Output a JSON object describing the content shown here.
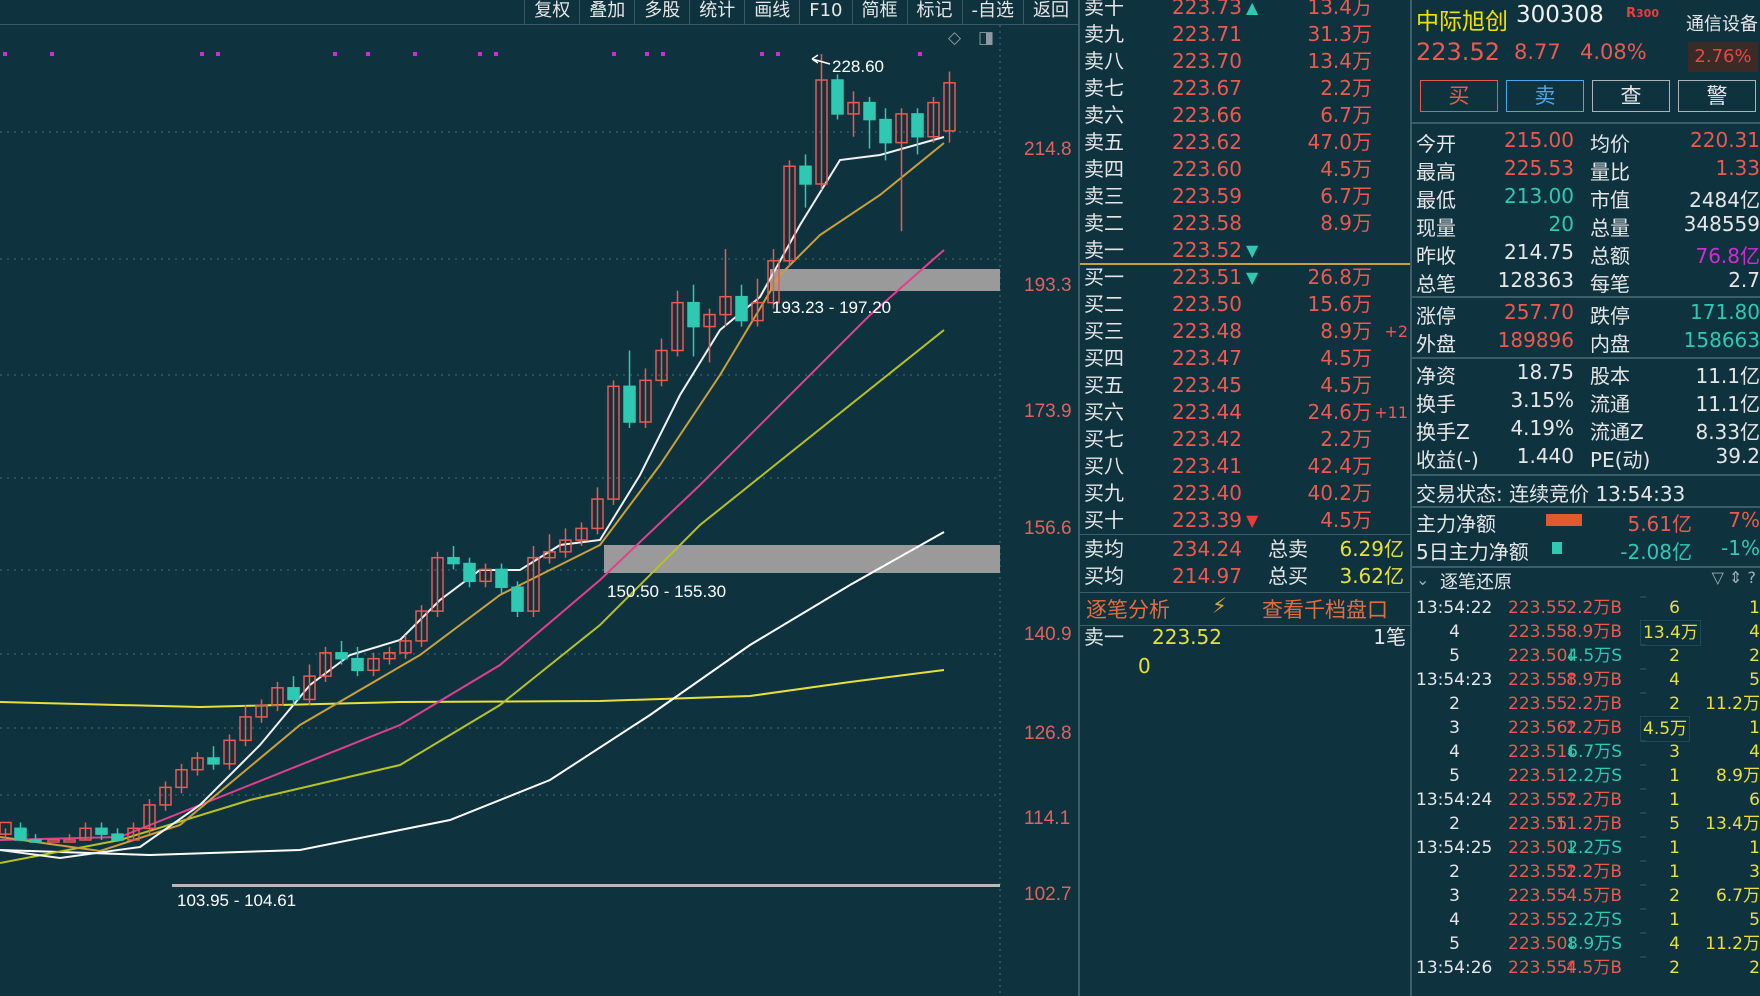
{
  "toolbar": {
    "buttons": [
      "复权",
      "叠加",
      "多股",
      "统计",
      "画线",
      "F10",
      "简框",
      "标记",
      "-自选",
      "返回"
    ]
  },
  "chart": {
    "price_axis": [
      "214.8",
      "193.3",
      "173.9",
      "156.6",
      "140.9",
      "126.8",
      "114.1",
      "102.7"
    ],
    "peak_label": "228.60",
    "zones": [
      "193.23 - 197.20",
      "150.50 - 155.30",
      "103.95 - 104.61"
    ]
  },
  "orderbook": {
    "asks": [
      {
        "label": "卖十",
        "price": "223.73",
        "vol": "13.4万"
      },
      {
        "label": "卖九",
        "price": "223.71",
        "vol": "31.3万"
      },
      {
        "label": "卖八",
        "price": "223.70",
        "vol": "13.4万"
      },
      {
        "label": "卖七",
        "price": "223.67",
        "vol": "2.2万"
      },
      {
        "label": "卖六",
        "price": "223.66",
        "vol": "6.7万"
      },
      {
        "label": "卖五",
        "price": "223.62",
        "vol": "47.0万"
      },
      {
        "label": "卖四",
        "price": "223.60",
        "vol": "4.5万"
      },
      {
        "label": "卖三",
        "price": "223.59",
        "vol": "6.7万"
      },
      {
        "label": "卖二",
        "price": "223.58",
        "vol": "8.9万"
      },
      {
        "label": "卖一",
        "price": "223.52",
        "vol": ""
      }
    ],
    "bids": [
      {
        "label": "买一",
        "price": "223.51",
        "vol": "26.8万",
        "delta": ""
      },
      {
        "label": "买二",
        "price": "223.50",
        "vol": "15.6万",
        "delta": ""
      },
      {
        "label": "买三",
        "price": "223.48",
        "vol": "8.9万",
        "delta": "+2"
      },
      {
        "label": "买四",
        "price": "223.47",
        "vol": "4.5万",
        "delta": ""
      },
      {
        "label": "买五",
        "price": "223.45",
        "vol": "4.5万",
        "delta": ""
      },
      {
        "label": "买六",
        "price": "223.44",
        "vol": "24.6万",
        "delta": "+11"
      },
      {
        "label": "买七",
        "price": "223.42",
        "vol": "2.2万",
        "delta": ""
      },
      {
        "label": "买八",
        "price": "223.41",
        "vol": "42.4万",
        "delta": ""
      },
      {
        "label": "买九",
        "price": "223.40",
        "vol": "40.2万",
        "delta": ""
      },
      {
        "label": "买十",
        "price": "223.39",
        "vol": "4.5万",
        "delta": ""
      }
    ],
    "summary": {
      "sell_avg_label": "卖均",
      "sell_avg": "234.24",
      "sell_total_label": "总卖",
      "sell_total": "6.29亿",
      "buy_avg_label": "买均",
      "buy_avg": "214.97",
      "buy_total_label": "总买",
      "buy_total": "3.62亿"
    },
    "links": {
      "analysis": "逐笔分析",
      "depth": "查看千档盘口"
    },
    "best_ask_label": "卖一",
    "best_ask_price": "223.52",
    "best_ask_count": "1笔",
    "queue_zero": "0"
  },
  "stock": {
    "name": "中际旭创",
    "code": "300308",
    "badge": "R",
    "sector": "通信设备",
    "sector_pct": "2.76%",
    "price": "223.52",
    "change": "8.77",
    "change_pct": "4.08%",
    "actions": [
      "买",
      "卖",
      "查",
      "警"
    ]
  },
  "stats": [
    [
      "今开",
      "215.00",
      "均价",
      "220.31"
    ],
    [
      "最高",
      "225.53",
      "量比",
      "1.33"
    ],
    [
      "最低",
      "213.00",
      "市值",
      "2484亿"
    ],
    [
      "现量",
      "20",
      "总量",
      "348559"
    ],
    [
      "昨收",
      "214.75",
      "总额",
      "76.8亿"
    ],
    [
      "总笔",
      "128363",
      "每笔",
      "2.7"
    ],
    [
      "涨停",
      "257.70",
      "跌停",
      "171.80"
    ],
    [
      "外盘",
      "189896",
      "内盘",
      "158663"
    ],
    [
      "净资",
      "18.75",
      "股本",
      "11.1亿"
    ],
    [
      "换手",
      "3.15%",
      "流通",
      "11.1亿"
    ],
    [
      "换手Z",
      "4.19%",
      "流通Z",
      "8.33亿"
    ],
    [
      "收益(-)",
      "1.440",
      "PE(动)",
      "39.2"
    ]
  ],
  "trade_status": "交易状态: 连续竞价 13:54:33",
  "flows": [
    {
      "label": "主力净额",
      "value": "5.61亿",
      "pct": "7%"
    },
    {
      "label": "5日主力净额",
      "value": "-2.08亿",
      "pct": "-1%"
    }
  ],
  "ticks_title": "逐笔还原",
  "ticks": [
    {
      "t": "13:54:22",
      "price": "223.55",
      "arrow": "",
      "vol": "2.2万B",
      "n": "6",
      "agg": "",
      "m": "1"
    },
    {
      "t": "4",
      "price": "223.55",
      "arrow": "",
      "vol": "8.9万B",
      "n": "",
      "agg": "13.4万",
      "m": "4"
    },
    {
      "t": "5",
      "price": "223.50",
      "arrow": "down",
      "vol": "4.5万S",
      "n": "2",
      "agg": "",
      "m": "2"
    },
    {
      "t": "13:54:23",
      "price": "223.55",
      "arrow": "up",
      "vol": "8.9万B",
      "n": "4",
      "agg": "",
      "m": "5"
    },
    {
      "t": "2",
      "price": "223.55",
      "arrow": "",
      "vol": "2.2万B",
      "n": "2",
      "agg": "",
      "m": "11.2万"
    },
    {
      "t": "3",
      "price": "223.56",
      "arrow": "up",
      "vol": "2.2万B",
      "n": "",
      "agg": "4.5万",
      "m": "1"
    },
    {
      "t": "4",
      "price": "223.51",
      "arrow": "down",
      "vol": "6.7万S",
      "n": "3",
      "agg": "",
      "m": "4"
    },
    {
      "t": "5",
      "price": "223.51",
      "arrow": "",
      "vol": "2.2万S",
      "n": "1",
      "agg": "",
      "m": "8.9万"
    },
    {
      "t": "13:54:24",
      "price": "223.55",
      "arrow": "up",
      "vol": "2.2万B",
      "n": "1",
      "agg": "",
      "m": "6"
    },
    {
      "t": "2",
      "price": "223.55",
      "arrow": "",
      "vol": "11.2万B",
      "n": "5",
      "agg": "",
      "m": "13.4万"
    },
    {
      "t": "13:54:25",
      "price": "223.50",
      "arrow": "down",
      "vol": "2.2万S",
      "n": "1",
      "agg": "",
      "m": "1"
    },
    {
      "t": "2",
      "price": "223.55",
      "arrow": "up",
      "vol": "2.2万B",
      "n": "1",
      "agg": "",
      "m": "3"
    },
    {
      "t": "3",
      "price": "223.55",
      "arrow": "",
      "vol": "4.5万B",
      "n": "2",
      "agg": "",
      "m": "6.7万"
    },
    {
      "t": "4",
      "price": "223.55",
      "arrow": "",
      "vol": "2.2万S",
      "n": "1",
      "agg": "",
      "m": "5"
    },
    {
      "t": "5",
      "price": "223.50",
      "arrow": "down",
      "vol": "8.9万S",
      "n": "4",
      "agg": "",
      "m": "11.2万"
    },
    {
      "t": "13:54:26",
      "price": "223.55",
      "arrow": "up",
      "vol": "4.5万B",
      "n": "2",
      "agg": "",
      "m": "2"
    }
  ],
  "colors": {
    "up": "#ea5a4e",
    "down": "#2fc9b3",
    "bg": "#0f323f"
  }
}
